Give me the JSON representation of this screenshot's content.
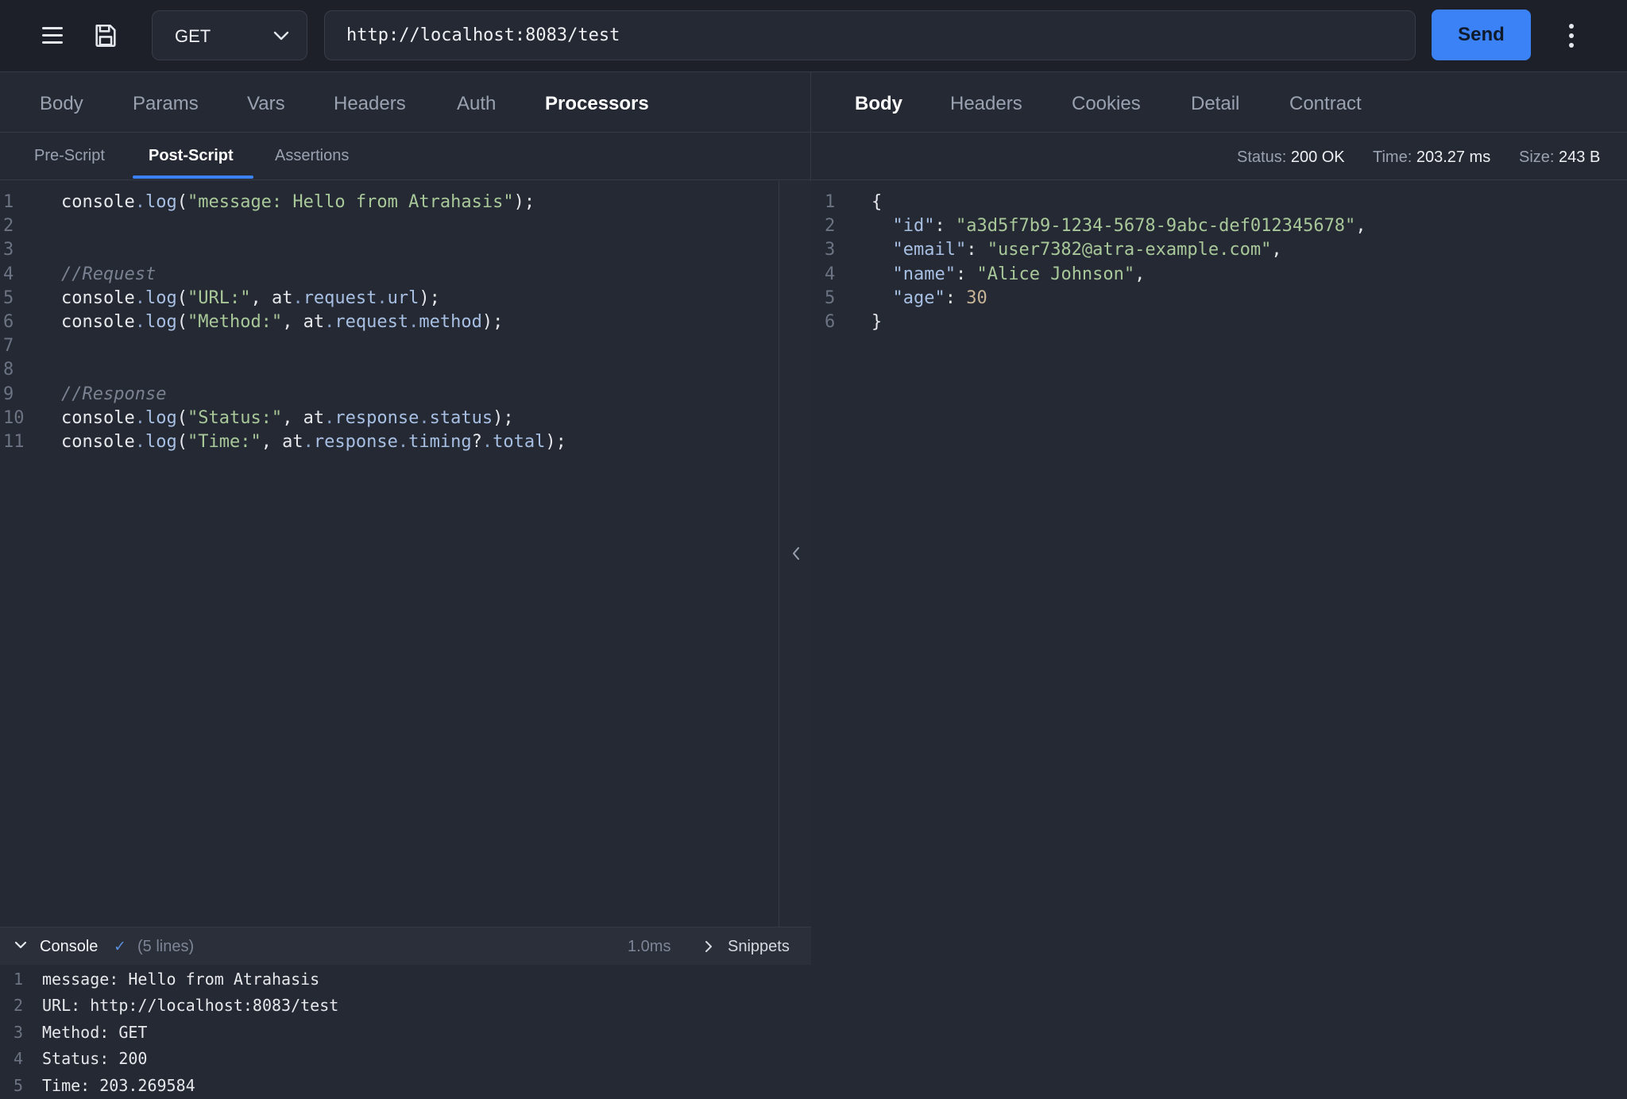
{
  "topbar": {
    "method": "GET",
    "url": "http://localhost:8083/test",
    "send_label": "Send"
  },
  "request_tabs": [
    "Body",
    "Params",
    "Vars",
    "Headers",
    "Auth",
    "Processors"
  ],
  "request_active_tab": "Processors",
  "processor_tabs": [
    "Pre-Script",
    "Post-Script",
    "Assertions"
  ],
  "processor_active_tab": "Post-Script",
  "script_lines": [
    {
      "n": "1",
      "segs": [
        [
          "obj",
          "console"
        ],
        [
          "dot",
          "."
        ],
        [
          "fn",
          "log"
        ],
        [
          "punc",
          "("
        ],
        [
          "str",
          "\"message: Hello from Atrahasis\""
        ],
        [
          "punc",
          ");"
        ]
      ]
    },
    {
      "n": "2",
      "segs": []
    },
    {
      "n": "3",
      "segs": []
    },
    {
      "n": "4",
      "segs": [
        [
          "cmt",
          "//Request"
        ]
      ]
    },
    {
      "n": "5",
      "segs": [
        [
          "obj",
          "console"
        ],
        [
          "dot",
          "."
        ],
        [
          "fn",
          "log"
        ],
        [
          "punc",
          "("
        ],
        [
          "str",
          "\"URL:\""
        ],
        [
          "punc",
          ", at"
        ],
        [
          "dot",
          "."
        ],
        [
          "prop",
          "request"
        ],
        [
          "dot",
          "."
        ],
        [
          "prop",
          "url"
        ],
        [
          "punc",
          ");"
        ]
      ]
    },
    {
      "n": "6",
      "segs": [
        [
          "obj",
          "console"
        ],
        [
          "dot",
          "."
        ],
        [
          "fn",
          "log"
        ],
        [
          "punc",
          "("
        ],
        [
          "str",
          "\"Method:\""
        ],
        [
          "punc",
          ", at"
        ],
        [
          "dot",
          "."
        ],
        [
          "prop",
          "request"
        ],
        [
          "dot",
          "."
        ],
        [
          "prop",
          "method"
        ],
        [
          "punc",
          ");"
        ]
      ]
    },
    {
      "n": "7",
      "segs": []
    },
    {
      "n": "8",
      "segs": []
    },
    {
      "n": "9",
      "segs": [
        [
          "cmt",
          "//Response"
        ]
      ]
    },
    {
      "n": "10",
      "segs": [
        [
          "obj",
          "console"
        ],
        [
          "dot",
          "."
        ],
        [
          "fn",
          "log"
        ],
        [
          "punc",
          "("
        ],
        [
          "str",
          "\"Status:\""
        ],
        [
          "punc",
          ", at"
        ],
        [
          "dot",
          "."
        ],
        [
          "prop",
          "response"
        ],
        [
          "dot",
          "."
        ],
        [
          "prop",
          "status"
        ],
        [
          "punc",
          ");"
        ]
      ]
    },
    {
      "n": "11",
      "segs": [
        [
          "obj",
          "console"
        ],
        [
          "dot",
          "."
        ],
        [
          "fn",
          "log"
        ],
        [
          "punc",
          "("
        ],
        [
          "str",
          "\"Time:\""
        ],
        [
          "punc",
          ", at"
        ],
        [
          "dot",
          "."
        ],
        [
          "prop",
          "response"
        ],
        [
          "dot",
          "."
        ],
        [
          "prop",
          "timing"
        ],
        [
          "punc",
          "?"
        ],
        [
          "dot",
          "."
        ],
        [
          "prop",
          "total"
        ],
        [
          "punc",
          ");"
        ]
      ]
    }
  ],
  "console": {
    "title": "Console",
    "check": "✓",
    "lines_count": "(5 lines)",
    "time": "1.0ms",
    "snippets_label": "Snippets",
    "lines": [
      {
        "n": "1",
        "text": "message: Hello from Atrahasis"
      },
      {
        "n": "2",
        "text": "URL: http://localhost:8083/test"
      },
      {
        "n": "3",
        "text": "Method: GET"
      },
      {
        "n": "4",
        "text": "Status: 200"
      },
      {
        "n": "5",
        "text": "Time: 203.269584"
      }
    ]
  },
  "response_tabs": [
    "Body",
    "Headers",
    "Cookies",
    "Detail",
    "Contract"
  ],
  "response_active_tab": "Body",
  "response_stats": {
    "status_label": "Status:",
    "status_value": "200 OK",
    "time_label": "Time:",
    "time_value": "203.27 ms",
    "size_label": "Size:",
    "size_value": "243 B"
  },
  "response_lines": [
    {
      "n": "1",
      "segs": [
        [
          "punc",
          "{"
        ]
      ]
    },
    {
      "n": "2",
      "segs": [
        [
          "punc",
          "  "
        ],
        [
          "key",
          "\"id\""
        ],
        [
          "punc",
          ": "
        ],
        [
          "str",
          "\"a3d5f7b9-1234-5678-9abc-def012345678\""
        ],
        [
          "punc",
          ","
        ]
      ]
    },
    {
      "n": "3",
      "segs": [
        [
          "punc",
          "  "
        ],
        [
          "key",
          "\"email\""
        ],
        [
          "punc",
          ": "
        ],
        [
          "str",
          "\"user7382@atra-example.com\""
        ],
        [
          "punc",
          ","
        ]
      ]
    },
    {
      "n": "4",
      "segs": [
        [
          "punc",
          "  "
        ],
        [
          "key",
          "\"name\""
        ],
        [
          "punc",
          ": "
        ],
        [
          "str",
          "\"Alice Johnson\""
        ],
        [
          "punc",
          ","
        ]
      ]
    },
    {
      "n": "5",
      "segs": [
        [
          "punc",
          "  "
        ],
        [
          "key",
          "\"age\""
        ],
        [
          "punc",
          ": "
        ],
        [
          "num",
          "30"
        ]
      ]
    },
    {
      "n": "6",
      "segs": [
        [
          "punc",
          "}"
        ]
      ]
    }
  ],
  "colors": {
    "accent": "#3b82f6",
    "background": "#252933",
    "topbar": "#1d2028"
  },
  "icons": {
    "menu": "menu-icon",
    "save": "save-icon",
    "dropdown": "chevron-down-icon",
    "more": "more-vertical-icon",
    "collapse": "chevron-left-icon"
  }
}
